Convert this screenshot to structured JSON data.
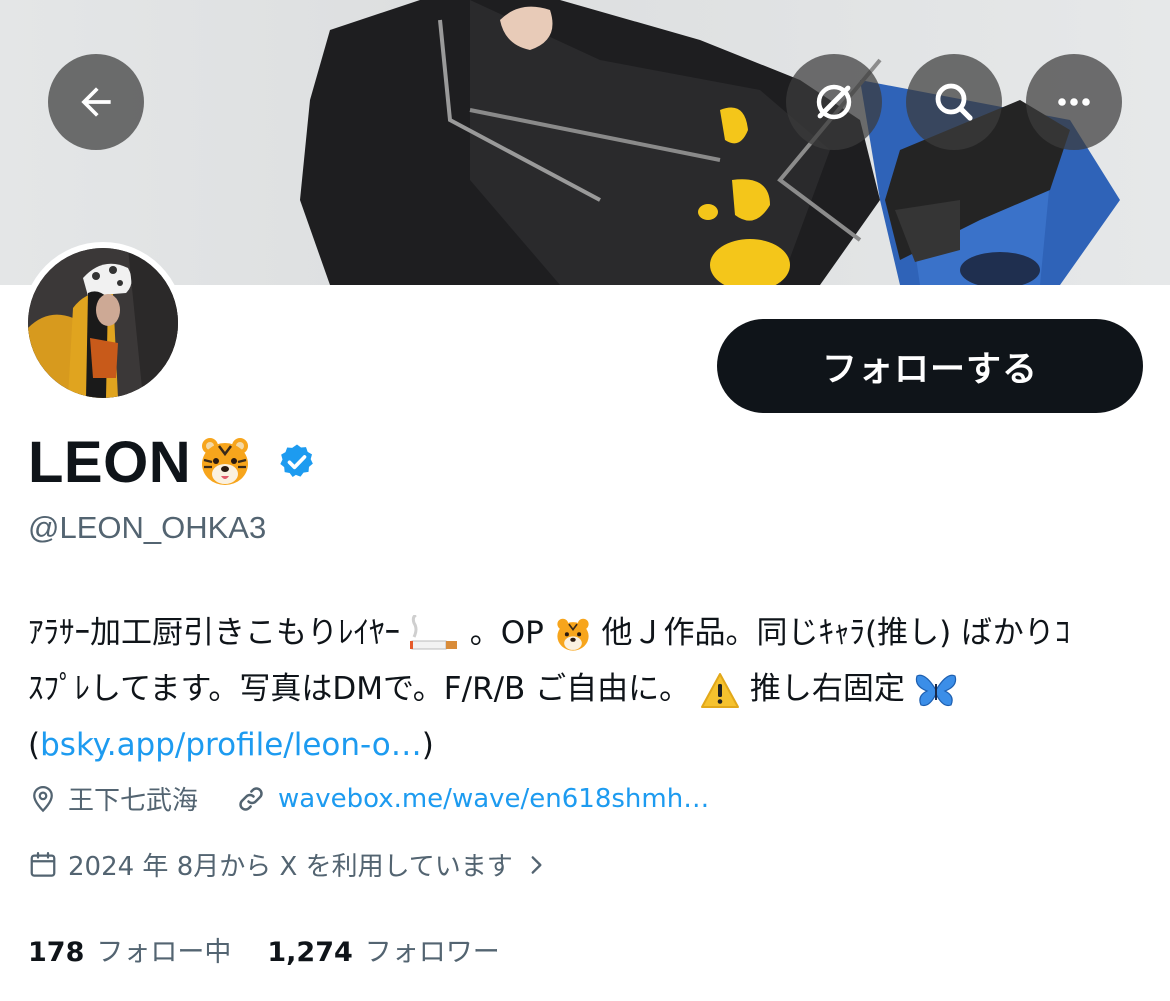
{
  "header": {
    "back_icon": "arrow-left-icon",
    "grok_icon": "grok-icon",
    "search_icon": "search-icon",
    "more_icon": "more-horizontal-icon"
  },
  "profile": {
    "display_name": "LEON",
    "name_emoji": "tiger-face-emoji",
    "verified": true,
    "handle": "@LEON_OHKA3",
    "follow_label": "フォローする",
    "bio": {
      "line1_a": "ｱﾗｻｰ加工厨引きこもりﾚｲﾔｰ",
      "line1_b": "。OP",
      "line1_c": "他Ｊ作品。同じｷｬﾗ(推し) ばかりｺ",
      "line2_a": "ｽﾌﾟﾚしてます。写真はDMで。F/R/B ご自由に。",
      "line2_b": "推し右固定",
      "line3_open": "(",
      "line3_link": "bsky.app/profile/leon-o…",
      "line3_close": ")"
    },
    "location": "王下七武海",
    "website": "wavebox.me/wave/en618shmh…",
    "joined": "2024 年 8月から X を利用しています",
    "following_count": "178",
    "following_label": "フォロー中",
    "followers_count": "1,274",
    "followers_label": "フォロワー"
  },
  "colors": {
    "accent": "#1d9bf0",
    "follow_button": "#0f1419",
    "secondary_text": "#536471"
  }
}
